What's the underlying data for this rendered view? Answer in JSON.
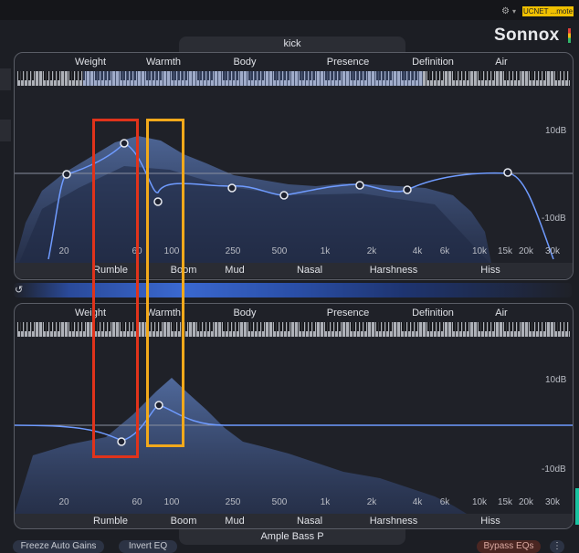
{
  "host": {
    "badge": "UCNET ...mote",
    "gear": "⚙",
    "drop": "▾"
  },
  "brand": {
    "name": "Sonnox"
  },
  "tracks": {
    "top": "kick",
    "bottom": "Ample Bass P"
  },
  "bands": [
    "Weight",
    "Warmth",
    "Body",
    "Presence",
    "Definition",
    "Air"
  ],
  "problems": [
    "Rumble",
    "Boom",
    "Mud",
    "Nasal",
    "Harshness",
    "Hiss"
  ],
  "freq_labels": [
    "20",
    "60",
    "100",
    "250",
    "500",
    "1k",
    "2k",
    "4k",
    "6k",
    "10k",
    "15k",
    "20k",
    "30k"
  ],
  "db": {
    "top": "10dB",
    "bottom": "-10dB"
  },
  "buttons": {
    "freeze": "Freeze Auto Gains",
    "invert": "Invert EQ",
    "bypass": "Bypass EQs",
    "more": "⋮"
  },
  "link_icon": "↺",
  "colors": {
    "accent": "#6f9bff",
    "red_box": "#e0331b",
    "yellow_box": "#f2a91b",
    "badge": "#f0c000"
  }
}
